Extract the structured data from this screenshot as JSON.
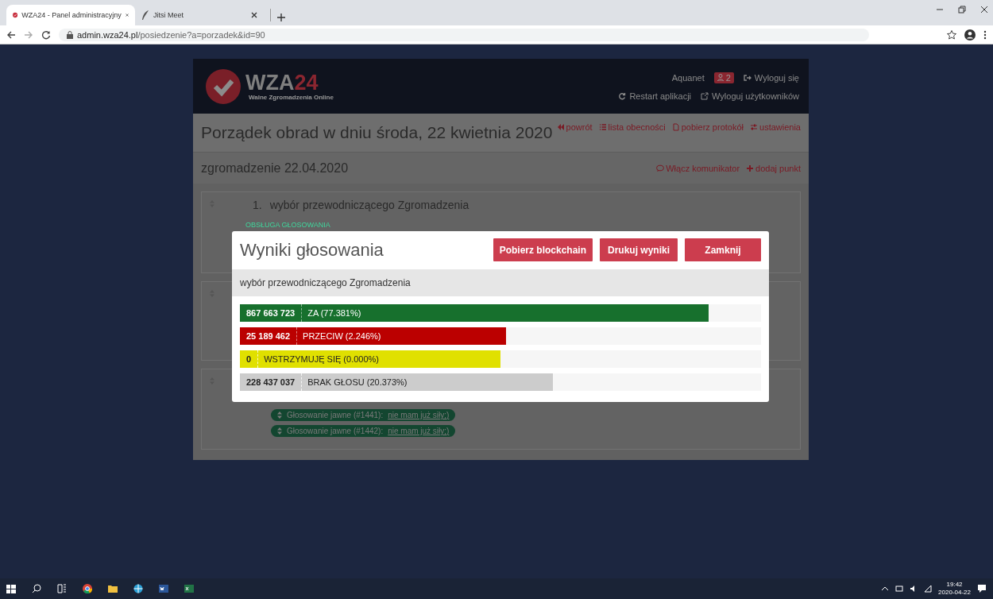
{
  "browser": {
    "tabs": [
      {
        "title": "WZA24 - Panel administracyjny",
        "selected": true
      },
      {
        "title": "Jitsi Meet",
        "selected": false
      }
    ],
    "url_host": "admin.wza24.pl",
    "url_path": "/posiedzenie?a=porzadek&id=90"
  },
  "header": {
    "logo_main": "WZA",
    "logo_number": "24",
    "logo_subtitle": "Walne Zgromadzenia Online",
    "user": "Aquanet",
    "user_badge": "2",
    "logout": "Wyloguj się",
    "links": [
      "Restart aplikacji",
      "Wyloguj użytkowników"
    ]
  },
  "page_title": "Porządek obrad w dniu środa, 22 kwietnia 2020",
  "page_actions": [
    "powrót",
    "lista obecności",
    "pobierz protokół",
    "ustawienia"
  ],
  "meeting": {
    "title": "zgromadzenie 22.04.2020",
    "actions": [
      "Włącz komunikator",
      "dodaj punkt"
    ]
  },
  "agenda_items": [
    {
      "kind": "item",
      "number": "1.",
      "title": "wybór przewodniczącego Zgromadzenia",
      "section": "OBSŁUGA GŁOSOWANIA"
    },
    {
      "kind": "covered"
    },
    {
      "kind": "item",
      "votings": [
        {
          "text": "Głosowanie jawne (#1441): ",
          "link": "nie mam już siły;)"
        },
        {
          "text": "Głosowanie jawne (#1442): ",
          "link": "nie mam już siły;)"
        }
      ]
    }
  ],
  "modal": {
    "title": "Wyniki głosowania",
    "buttons": [
      "Pobierz blockchain",
      "Drukuj wyniki",
      "Zamknij"
    ],
    "question": "wybór przewodniczącego Zgromadzenia",
    "results": [
      {
        "count": "867 663 723",
        "label": "ZA (77.381%)",
        "color": "#17702d",
        "level": 0.9
      },
      {
        "count": "25 189 462",
        "label": "PRZECIW (2.246%)",
        "color": "#bb0000",
        "level": 0.51
      },
      {
        "count": "0",
        "label": "WSTRZYMUJĘ SIĘ (0.000%)",
        "color": "#e0e000",
        "level": 0.5
      },
      {
        "count": "228 437 037",
        "label": "BRAK GŁOSU (20.373%)",
        "color": "#cccccc",
        "level": 0.6
      }
    ]
  },
  "taskbar": {
    "time": "19:42",
    "date": "2020-04-22"
  }
}
